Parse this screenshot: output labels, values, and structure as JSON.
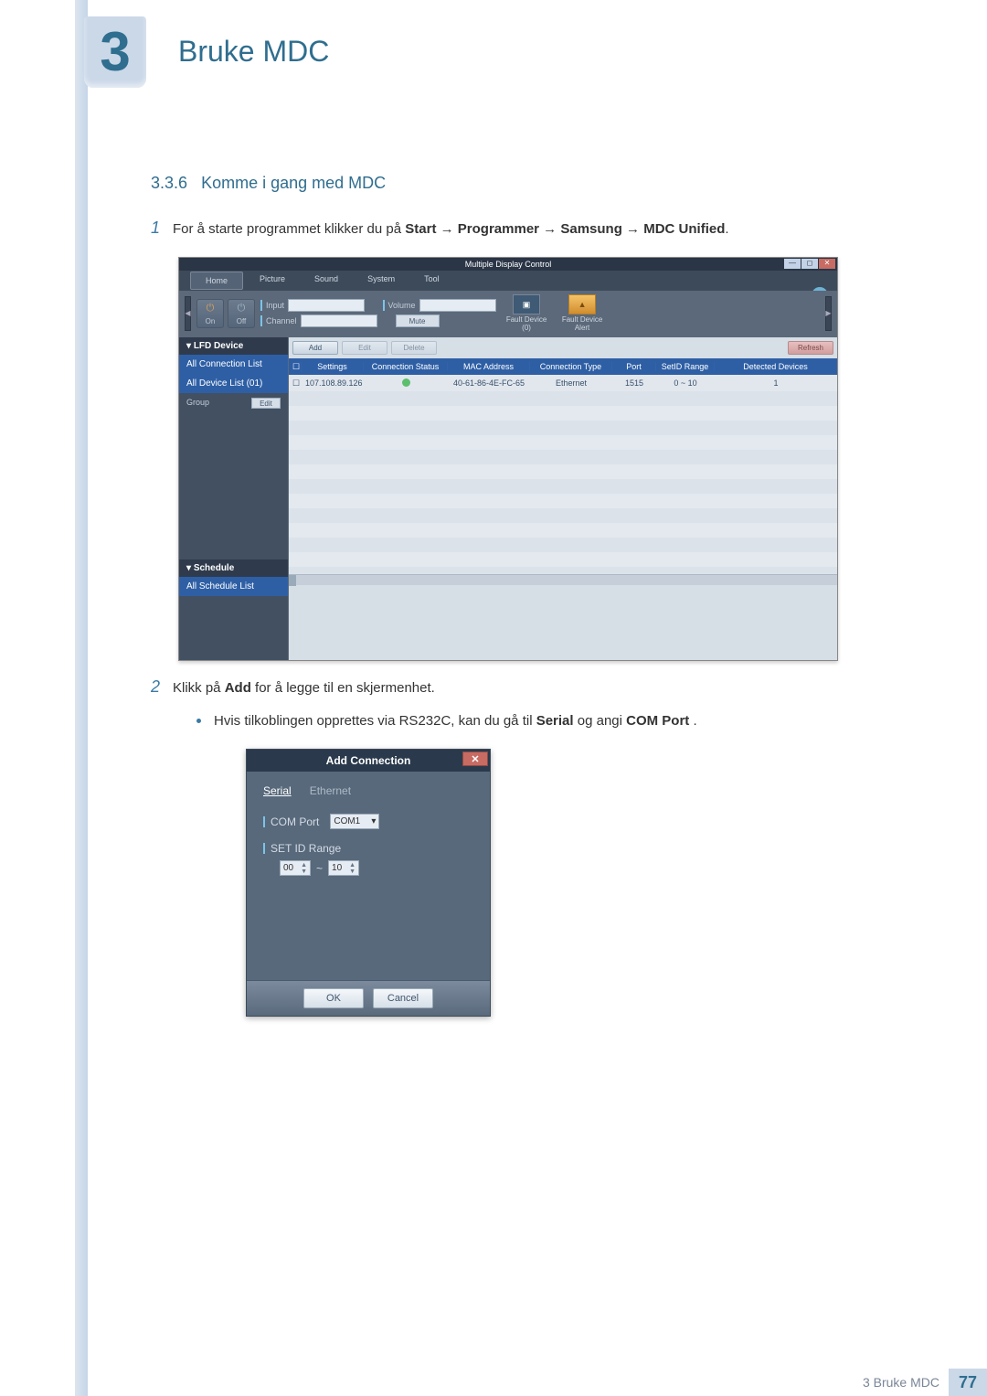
{
  "chapter": {
    "number": "3",
    "title": "Bruke MDC"
  },
  "section": {
    "number": "3.3.6",
    "title": "Komme i gang med MDC"
  },
  "step1": {
    "num": "1",
    "pre": "For å starte programmet klikker du på ",
    "b1": "Start",
    "a1": " → ",
    "b2": "Programmer",
    "a2": " → ",
    "b3": "Samsung",
    "a3": " → ",
    "b4": "MDC Unified",
    "post": "."
  },
  "step2": {
    "num": "2",
    "pre": "Klikk på ",
    "b1": "Add",
    "post": " for å legge til en skjermenhet."
  },
  "bullet1": {
    "pre": "Hvis tilkoblingen opprettes via RS232C, kan du gå til ",
    "b1": "Serial",
    "mid": " og angi ",
    "b2": "COM Port",
    "post": "."
  },
  "mdc": {
    "title": "Multiple Display Control",
    "menu": {
      "home": "Home",
      "picture": "Picture",
      "sound": "Sound",
      "system": "System",
      "tool": "Tool"
    },
    "toolbar": {
      "on": "On",
      "off": "Off",
      "input_label": "Input",
      "channel_label": "Channel",
      "volume_label": "Volume",
      "mute_btn": "Mute",
      "fault0": "Fault Device (0)",
      "fault_alert": "Fault Device Alert"
    },
    "left": {
      "lfd": "LFD Device",
      "all_conn": "All Connection List",
      "all_dev": "All Device List (01)",
      "group": "Group",
      "edit": "Edit",
      "schedule": "Schedule",
      "all_sched": "All Schedule List"
    },
    "btns": {
      "add": "Add",
      "edit": "Edit",
      "delete": "Delete",
      "refresh": "Refresh"
    },
    "cols": {
      "settings": "Settings",
      "conn": "Connection Status",
      "mac": "MAC Address",
      "ctype": "Connection Type",
      "port": "Port",
      "range": "SetID Range",
      "det": "Detected Devices"
    },
    "row": {
      "settings": "107.108.89.126",
      "mac": "40-61-86-4E-FC-65",
      "ctype": "Ethernet",
      "port": "1515",
      "range": "0 ~ 10",
      "det": "1"
    }
  },
  "dialog": {
    "title": "Add Connection",
    "tab_serial": "Serial",
    "tab_eth": "Ethernet",
    "comport_label": "COM Port",
    "comport_val": "COM1",
    "range_label": "SET ID Range",
    "range_from": "00",
    "range_sep": "~",
    "range_to": "10",
    "ok": "OK",
    "cancel": "Cancel"
  },
  "footer": {
    "label": "3 Bruke MDC",
    "page": "77"
  },
  "win": {
    "min": "—",
    "max": "◻",
    "close": "✕",
    "help": "?"
  }
}
